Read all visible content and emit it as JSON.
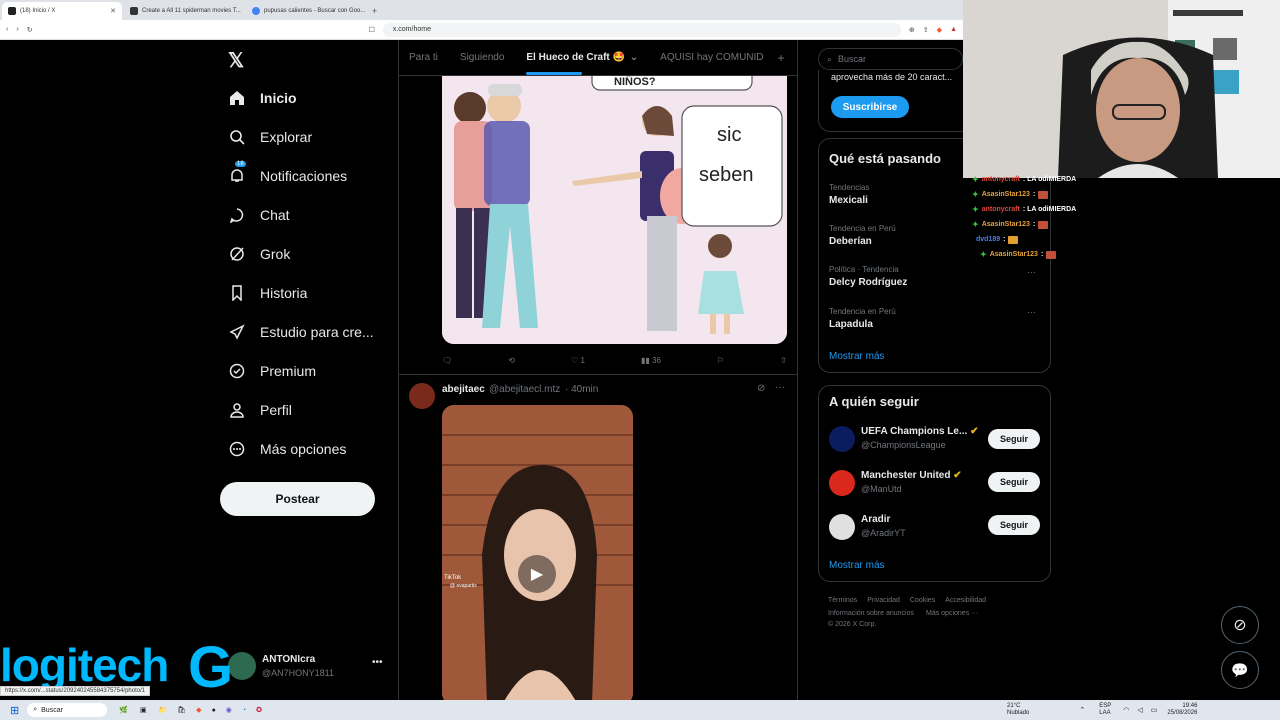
{
  "browser": {
    "tabs": [
      {
        "label": "(18) Inicio / X",
        "active": true
      },
      {
        "label": "Create a All 11 spiderman movies T...",
        "active": false
      },
      {
        "label": "pupusas calientes - Buscar con Goo...",
        "active": false
      }
    ],
    "url": "x.com/home",
    "status_url": "https://x.com/...status/209240245584375754/photo/1"
  },
  "leftnav": {
    "items": [
      {
        "label": "Inicio",
        "icon": "home-icon"
      },
      {
        "label": "Explorar",
        "icon": "search-icon"
      },
      {
        "label": "Notificaciones",
        "icon": "bell-icon",
        "badge": "18"
      },
      {
        "label": "Chat",
        "icon": "chat-bubble-icon"
      },
      {
        "label": "Grok",
        "icon": "grok-icon"
      },
      {
        "label": "Historia",
        "icon": "bookmark-icon"
      },
      {
        "label": "Estudio para cre...",
        "icon": "rocket-icon"
      },
      {
        "label": "Premium",
        "icon": "verified-icon"
      },
      {
        "label": "Perfil",
        "icon": "person-icon"
      },
      {
        "label": "Más opciones",
        "icon": "more-circle-icon"
      }
    ],
    "post_label": "Postear",
    "account": {
      "name": "ANTONIcra",
      "handle": "@AN7HONY1811"
    }
  },
  "timeline": {
    "tabs": [
      "Para ti",
      "Siguiendo",
      "El Hueco de Craft 🤩",
      "AQUISI hay COMUNID"
    ],
    "meme": {
      "top_text": "NIÑOS?",
      "bubble_line1": "sic",
      "bubble_line2": "seben"
    },
    "post1_actions": {
      "likes": "1",
      "views": "36"
    },
    "post2": {
      "name": "abejitaec",
      "handle": "@abejitaecl.mtz",
      "time": "· 40min",
      "video_watermark": "TikTok",
      "video_user": "@ evapartis"
    }
  },
  "sidebar": {
    "search_placeholder": "Buscar",
    "premium_text": "aprovecha más de 20 caract...",
    "subscribe_label": "Suscribirse",
    "trends_title": "Qué está pasando",
    "trends": [
      {
        "meta": "Tendencias",
        "name": "Mexicali"
      },
      {
        "meta": "Tendencia en Perú",
        "name": "Deberían"
      },
      {
        "meta": "Política · Tendencia",
        "name": "Delcy Rodríguez"
      },
      {
        "meta": "Tendencia en Perú",
        "name": "Lapadula"
      }
    ],
    "show_more": "Mostrar más",
    "follow_title": "A quién seguir",
    "follow": [
      {
        "name": "UEFA Champions Le...",
        "handle": "@ChampionsLeague"
      },
      {
        "name": "Manchester United",
        "handle": "@ManUtd"
      },
      {
        "name": "Aradir",
        "handle": "@AradirYT"
      }
    ],
    "follow_label": "Seguir",
    "footer_line1": [
      "Términos",
      "Privacidad",
      "Cookies",
      "Accesibilidad"
    ],
    "footer_line2": [
      "Información sobre anuncios",
      "Más opciones ···"
    ],
    "copyright": "© 2026 X Corp."
  },
  "stream_chat": [
    {
      "user": "antonycraft",
      "msg": ": LA odiMIERDA",
      "color": "#e0463b"
    },
    {
      "user": "AsasinStar123",
      "msg": ":",
      "color": "#e8a33a"
    },
    {
      "user": "antonycraft",
      "msg": ": LA odiMIERDA",
      "color": "#e0463b"
    },
    {
      "user": "AsasinStar123",
      "msg": ":",
      "color": "#e8a33a"
    },
    {
      "user": "dvd189",
      "msg": ":",
      "color": "#4a7ee8"
    },
    {
      "user": "AsasinStar123",
      "msg": ":",
      "color": "#e8a33a"
    }
  ],
  "overlay": {
    "brand": "logitech"
  },
  "taskbar": {
    "search_placeholder": "Buscar",
    "weather_temp": "21°C",
    "weather_desc": "Nublado",
    "lang": "ESP",
    "lang2": "LAA",
    "time": "19:46",
    "date": "25/08/2026"
  },
  "colors": {
    "accent": "#1d9bf0",
    "background": "#000000",
    "border": "#2f3336",
    "muted": "#71767b"
  }
}
